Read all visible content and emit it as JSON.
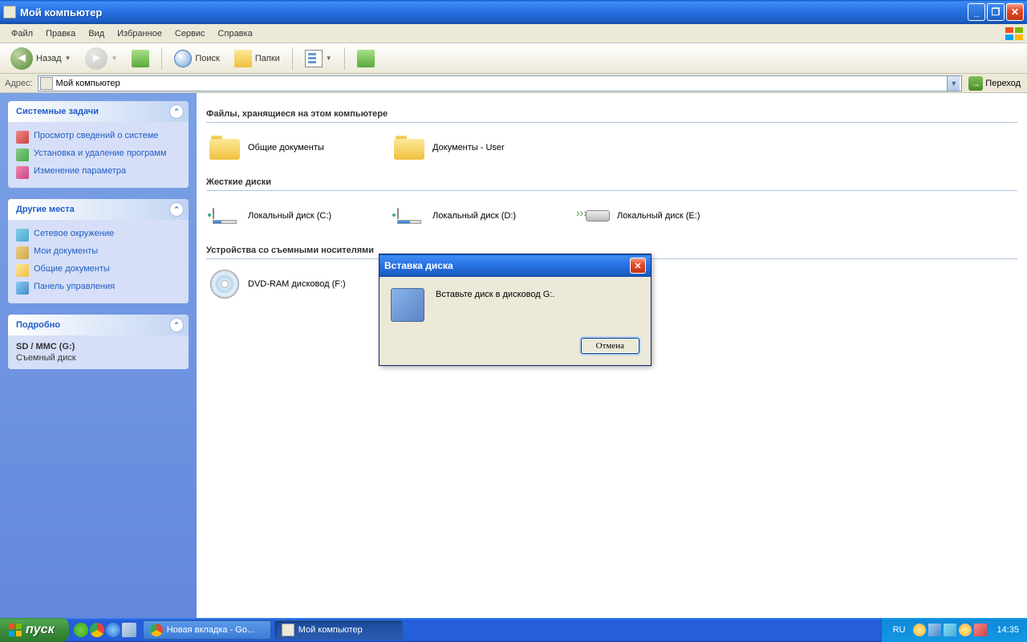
{
  "window": {
    "title": "Мой компьютер"
  },
  "menu": {
    "file": "Файл",
    "edit": "Правка",
    "view": "Вид",
    "favorites": "Избранное",
    "tools": "Сервис",
    "help": "Справка"
  },
  "toolbar": {
    "back": "Назад",
    "search": "Поиск",
    "folders": "Папки"
  },
  "addressbar": {
    "label": "Адрес:",
    "value": "Мой компьютер",
    "go": "Переход"
  },
  "sidebar": {
    "tasks": {
      "title": "Системные задачи",
      "items": [
        "Просмотр сведений о системе",
        "Установка и удаление программ",
        "Изменение параметра"
      ]
    },
    "places": {
      "title": "Другие места",
      "items": [
        "Сетевое окружение",
        "Мои документы",
        "Общие документы",
        "Панель управления"
      ]
    },
    "details": {
      "title": "Подробно",
      "name": "SD / MMC (G:)",
      "type": "Съемный диск"
    }
  },
  "content": {
    "group_files": "Файлы, хранящиеся на этом компьютере",
    "files": [
      "Общие документы",
      "Документы - User"
    ],
    "group_disks": "Жесткие диски",
    "disks": [
      "Локальный диск (C:)",
      "Локальный диск (D:)",
      "Локальный диск (E:)"
    ],
    "group_removable": "Устройства со съемными носителями",
    "removable": [
      "DVD-RAM дисковод (F:)"
    ]
  },
  "dialog": {
    "title": "Вставка диска",
    "message": "Вставьте диск в дисковод G:.",
    "cancel": "Отмена"
  },
  "taskbar": {
    "start": "пуск",
    "tab1": "Новая вкладка - Go...",
    "tab2": "Мой компьютер",
    "lang": "RU",
    "time": "14:35"
  }
}
